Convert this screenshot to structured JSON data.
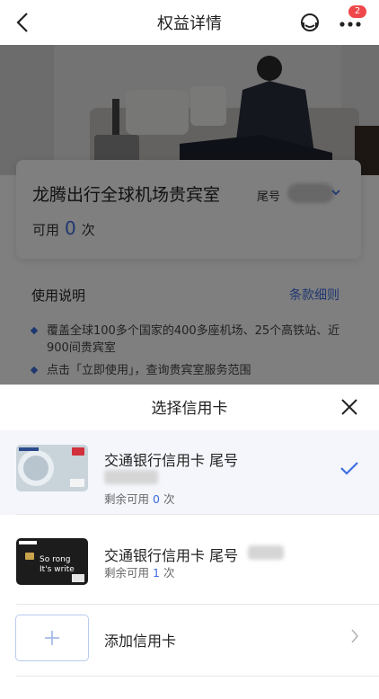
{
  "header": {
    "title": "权益详情",
    "badge": "2",
    "back_icon": "chevron-left-icon",
    "support_icon": "headset-icon",
    "more_icon": "more-icon"
  },
  "benefit": {
    "title": "龙腾出行全球机场贵宾室",
    "tail_label": "尾号",
    "available_prefix": "可用",
    "available_count": "0",
    "available_suffix": "次"
  },
  "usage": {
    "title": "使用说明",
    "terms_link": "条款细则",
    "bullets": [
      "覆盖全球100多个国家的400多座机场、25个高铁站、近900间贵宾室",
      "点击「立即使用」，查询贵宾室服务范围"
    ]
  },
  "sheet": {
    "title": "选择信用卡",
    "close_icon": "close-icon",
    "cards": [
      {
        "name": "交通银行信用卡 尾号",
        "remaining_prefix": "剩余可用",
        "remaining": "0",
        "remaining_suffix": "次",
        "selected": true
      },
      {
        "name": "交通银行信用卡 尾号",
        "remaining_prefix": "剩余可用",
        "remaining": "1",
        "remaining_suffix": "次",
        "selected": false
      }
    ],
    "add_label": "添加信用卡"
  },
  "card_art": {
    "card2_text_line1": "So rong",
    "card2_text_line2": "It's write"
  },
  "colors": {
    "accent": "#3f6ee0",
    "badge": "#f0474a",
    "overlay": "rgba(0,0,0,0.5)"
  }
}
